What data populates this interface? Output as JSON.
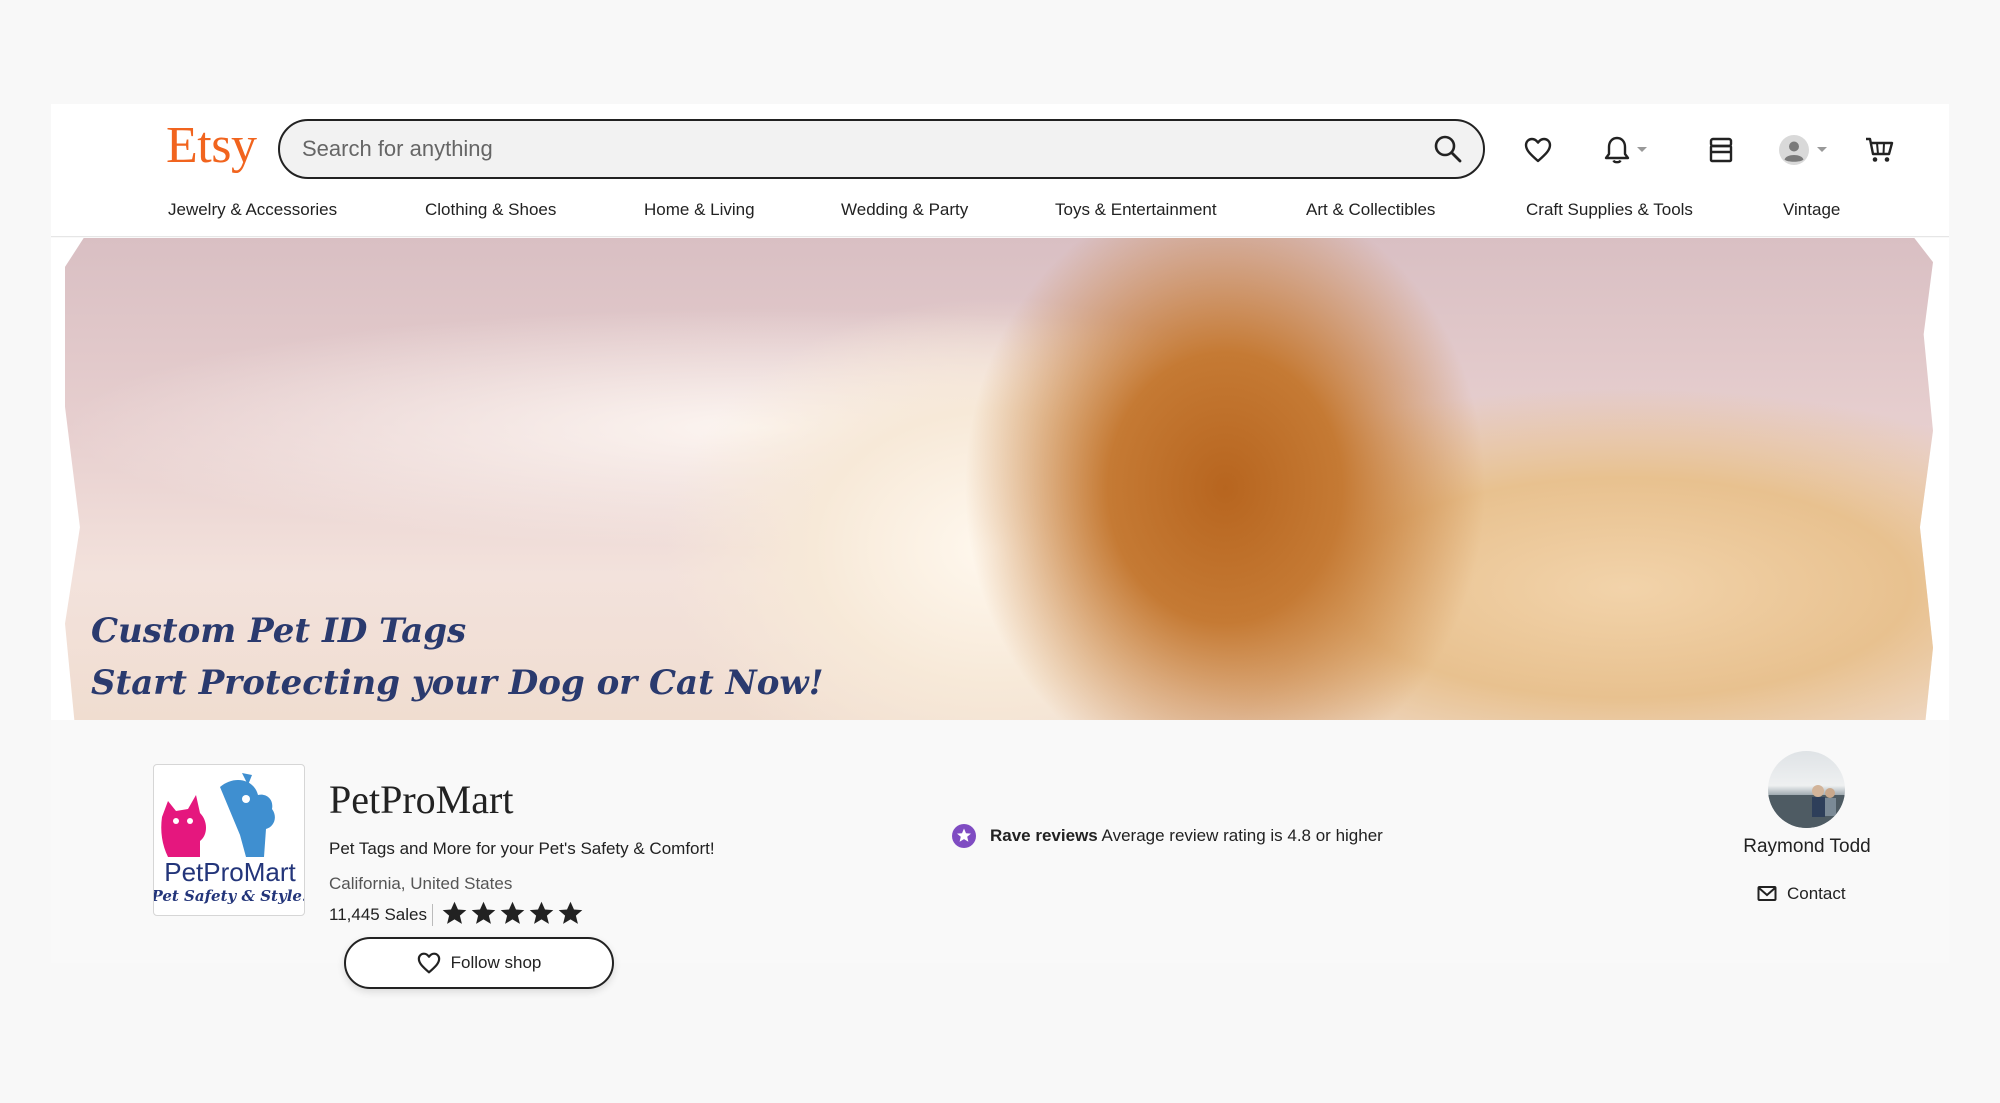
{
  "header": {
    "logo": "Etsy",
    "search": {
      "placeholder": "Search for anything"
    },
    "icons": [
      "heart-icon",
      "bell-icon",
      "shop-icon",
      "account-icon",
      "cart-icon"
    ]
  },
  "nav": {
    "items": [
      "Jewelry & Accessories",
      "Clothing & Shoes",
      "Home & Living",
      "Wedding & Party",
      "Toys & Entertainment",
      "Art & Collectibles",
      "Craft Supplies & Tools",
      "Vintage"
    ]
  },
  "banner": {
    "line1": "Custom Pet ID Tags",
    "line2": "Start Protecting your Dog or Cat Now!"
  },
  "shop": {
    "logo_text": "PetProMart",
    "logo_subtext": "Pet Safety & Style!",
    "name": "PetProMart",
    "tagline": "Pet Tags and More for your Pet's Safety & Comfort!",
    "location": "California, United States",
    "sales": "11,445 Sales",
    "rating_stars": 5,
    "follow_label": "Follow shop"
  },
  "rave": {
    "title": "Rave reviews",
    "text": "Average review rating is 4.8 or higher"
  },
  "owner": {
    "name": "Raymond Todd",
    "contact_label": "Contact"
  },
  "colors": {
    "brand": "#f1641e",
    "rave_badge": "#7f4cc2",
    "banner_text": "#2a3a6e"
  }
}
